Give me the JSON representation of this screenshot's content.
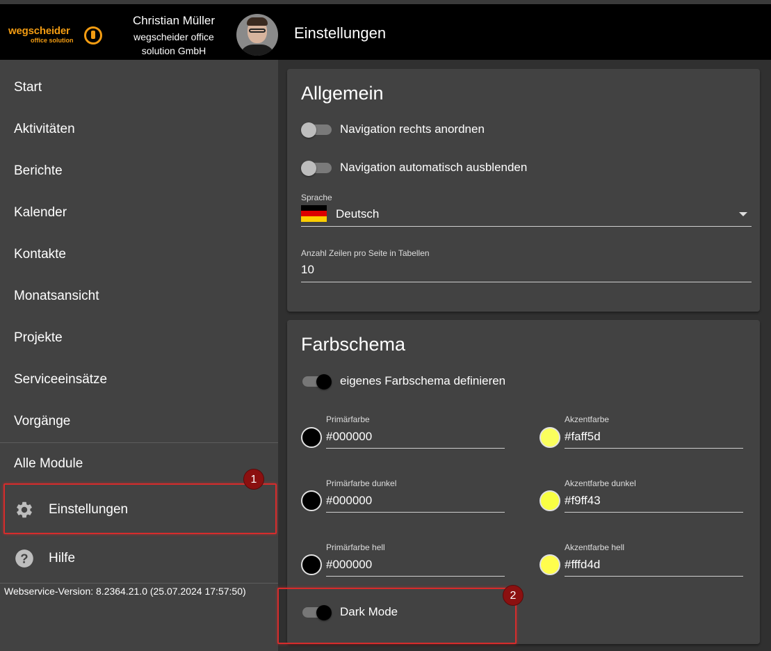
{
  "header": {
    "logo_word": "wegscheider",
    "logo_sub": "office solution",
    "user_name": "Christian Müller",
    "user_company": "wegscheider office solution GmbH",
    "page_title": "Einstellungen"
  },
  "sidebar": {
    "items": [
      {
        "label": "Start"
      },
      {
        "label": "Aktivitäten"
      },
      {
        "label": "Berichte"
      },
      {
        "label": "Kalender"
      },
      {
        "label": "Kontakte"
      },
      {
        "label": "Monatsansicht"
      },
      {
        "label": "Projekte"
      },
      {
        "label": "Serviceeinsätze"
      },
      {
        "label": "Vorgänge"
      }
    ],
    "all_modules": "Alle Module",
    "settings": "Einstellungen",
    "help": "Hilfe",
    "version": "Webservice-Version: 8.2364.21.0 (25.07.2024 17:57:50)"
  },
  "annotations": {
    "badge1": "1",
    "badge2": "2",
    "highlight_color": "#d62c2c"
  },
  "general": {
    "title": "Allgemein",
    "nav_right": {
      "label": "Navigation rechts anordnen",
      "on": false
    },
    "nav_autohide": {
      "label": "Navigation automatisch ausblenden",
      "on": false
    },
    "language": {
      "label": "Sprache",
      "value": "Deutsch",
      "flag": "german-flag-icon"
    },
    "rows_per_page": {
      "label": "Anzahl Zeilen pro Seite in Tabellen",
      "value": "10"
    }
  },
  "color_scheme": {
    "title": "Farbschema",
    "custom": {
      "label": "eigenes Farbschema definieren",
      "on": true
    },
    "primary": {
      "label": "Primärfarbe",
      "value": "#000000",
      "color": "#000000"
    },
    "primary_dark": {
      "label": "Primärfarbe dunkel",
      "value": "#000000",
      "color": "#000000"
    },
    "primary_light": {
      "label": "Primärfarbe hell",
      "value": "#000000",
      "color": "#000000"
    },
    "accent": {
      "label": "Akzentfarbe",
      "value": "#faff5d",
      "color": "#faff5d"
    },
    "accent_dark": {
      "label": "Akzentfarbe dunkel",
      "value": "#f9ff43",
      "color": "#f9ff43"
    },
    "accent_light": {
      "label": "Akzentfarbe hell",
      "value": "#fffd4d",
      "color": "#fffd4d"
    },
    "dark_mode": {
      "label": "Dark Mode",
      "on": true
    }
  }
}
